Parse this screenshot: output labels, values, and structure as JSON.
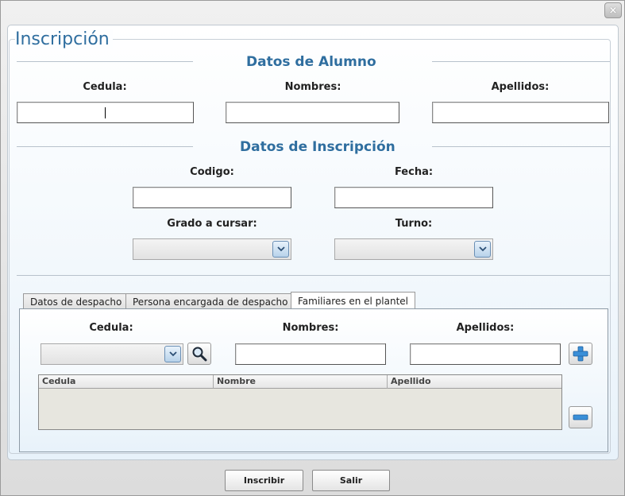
{
  "window": {
    "close_label": "×"
  },
  "form": {
    "title": "Inscripción",
    "student_section": {
      "title": "Datos de Alumno",
      "cedula_label": "Cedula:",
      "nombres_label": "Nombres:",
      "apellidos_label": "Apellidos:",
      "cedula_value": "",
      "nombres_value": "",
      "apellidos_value": ""
    },
    "enrollment_section": {
      "title": "Datos de Inscripción",
      "codigo_label": "Codigo:",
      "fecha_label": "Fecha:",
      "grado_label": "Grado a cursar:",
      "turno_label": "Turno:",
      "codigo_value": "",
      "fecha_value": "",
      "grado_value": "",
      "turno_value": ""
    },
    "tabs": [
      {
        "label": "Datos de despacho"
      },
      {
        "label": "Persona encargada de despacho"
      },
      {
        "label": "Familiares en el plantel"
      }
    ],
    "relatives": {
      "cedula_label": "Cedula:",
      "nombres_label": "Nombres:",
      "apellidos_label": "Apellidos:",
      "cedula_value": "",
      "nombres_value": "",
      "apellidos_value": "",
      "columns": [
        "Cedula",
        "Nombre",
        "Apellido"
      ],
      "rows": []
    },
    "buttons": {
      "submit": "Inscribir",
      "exit": "Salir"
    }
  },
  "colors": {
    "accent": "#2f6e9f",
    "plus_icon": "#3a8fd8"
  },
  "icons": {
    "search": "magnifier-icon",
    "add": "plus-icon",
    "remove": "minus-icon",
    "dropdown": "chevron-down-icon",
    "close": "close-icon"
  }
}
